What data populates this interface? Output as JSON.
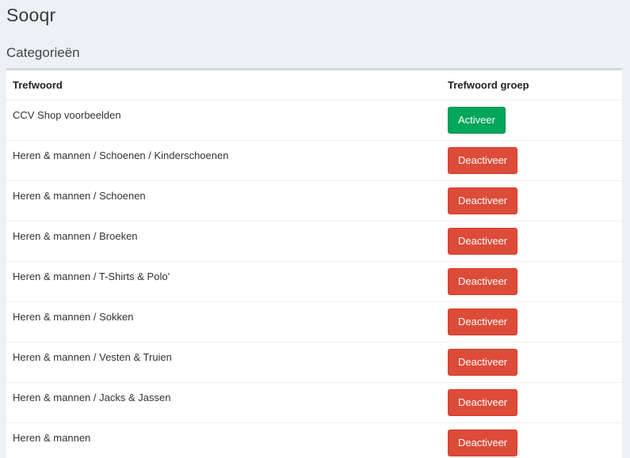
{
  "app": {
    "title": "Sooqr"
  },
  "section": {
    "title": "Categorieën"
  },
  "table": {
    "columns": [
      "Trefwoord",
      "Trefwoord groep"
    ],
    "rows": [
      {
        "keyword": "CCV Shop voorbeelden",
        "action": "Activeer",
        "state": "inactive"
      },
      {
        "keyword": "Heren & mannen / Schoenen / Kinderschoenen",
        "action": "Deactiveer",
        "state": "active"
      },
      {
        "keyword": "Heren & mannen / Schoenen",
        "action": "Deactiveer",
        "state": "active"
      },
      {
        "keyword": "Heren & mannen / Broeken",
        "action": "Deactiveer",
        "state": "active"
      },
      {
        "keyword": "Heren & mannen / T-Shirts & Polo'",
        "action": "Deactiveer",
        "state": "active"
      },
      {
        "keyword": "Heren & mannen / Sokken",
        "action": "Deactiveer",
        "state": "active"
      },
      {
        "keyword": "Heren & mannen / Vesten & Truien",
        "action": "Deactiveer",
        "state": "active"
      },
      {
        "keyword": "Heren & mannen / Jacks & Jassen",
        "action": "Deactiveer",
        "state": "active"
      },
      {
        "keyword": "Heren & mannen",
        "action": "Deactiveer",
        "state": "active"
      }
    ]
  },
  "colors": {
    "activate": "#00a65a",
    "deactivate": "#dd4b39",
    "page_background": "#edf0f5"
  }
}
